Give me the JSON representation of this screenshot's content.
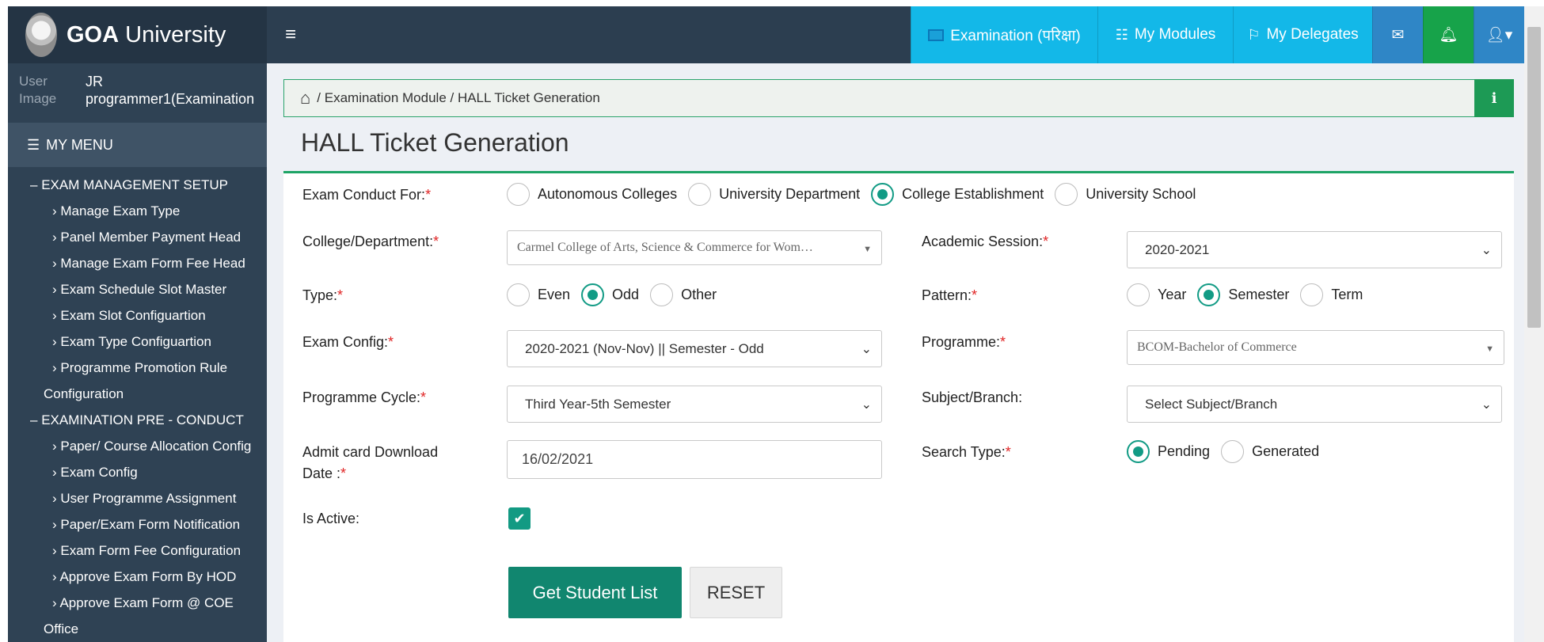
{
  "header": {
    "brand_bold": "GOA",
    "brand_rest": " University",
    "menu_toggle": "≡",
    "nav": {
      "examination": "Examination (परिक्षा)",
      "modules": "My Modules",
      "delegates": "My Delegates"
    }
  },
  "sidebar": {
    "user_image_alt": "User Image",
    "user_name": "JR programmer1(Examination",
    "menu_title": "MY MENU",
    "section1": "EXAM MANAGEMENT SETUP",
    "section1_items": [
      "Manage Exam Type",
      "Panel Member Payment Head",
      "Manage Exam Form Fee Head",
      "Exam Schedule Slot Master",
      "Exam Slot Configuartion",
      "Exam Type Configuartion",
      "Programme Promotion Rule"
    ],
    "section1_item7_cont": "Configuration",
    "section2": "EXAMINATION PRE - CONDUCT",
    "section2_items": [
      "Paper/ Course Allocation Config",
      "Exam Config",
      "User Programme Assignment",
      "Paper/Exam Form Notification",
      "Exam Form Fee Configuration",
      "Approve Exam Form By HOD",
      "Approve Exam Form @ COE"
    ],
    "section2_item7_cont": "Office"
  },
  "breadcrumb": {
    "path": "/ Examination Module / HALL Ticket Generation"
  },
  "page": {
    "title": "HALL Ticket Generation"
  },
  "form": {
    "exam_conduct_for": {
      "label": "Exam Conduct For:",
      "options": [
        "Autonomous Colleges",
        "University Department",
        "College Establishment",
        "University School"
      ],
      "selected": "College Establishment"
    },
    "college_department": {
      "label": "College/Department:",
      "value": "Carmel College of Arts, Science & Commerce for Wom…"
    },
    "academic_session": {
      "label": "Academic Session:",
      "value": "2020-2021"
    },
    "type": {
      "label": "Type:",
      "options": [
        "Even",
        "Odd",
        "Other"
      ],
      "selected": "Odd"
    },
    "pattern": {
      "label": "Pattern:",
      "options": [
        "Year",
        "Semester",
        "Term"
      ],
      "selected": "Semester"
    },
    "exam_config": {
      "label": "Exam Config:",
      "value": "2020-2021 (Nov-Nov) || Semester - Odd"
    },
    "programme": {
      "label": "Programme:",
      "value": "BCOM-Bachelor of Commerce"
    },
    "programme_cycle": {
      "label": "Programme Cycle:",
      "value": "Third Year-5th Semester"
    },
    "subject_branch": {
      "label": "Subject/Branch:",
      "value": "Select Subject/Branch"
    },
    "admit_card": {
      "label_line1": "Admit card Download",
      "label_line2": "Date :",
      "value": "16/02/2021"
    },
    "search_type": {
      "label": "Search Type:",
      "options": [
        "Pending",
        "Generated"
      ],
      "selected": "Pending"
    },
    "is_active": {
      "label": "Is Active:",
      "checked": true
    },
    "get_student_list": "Get Student List",
    "reset": "RESET"
  }
}
